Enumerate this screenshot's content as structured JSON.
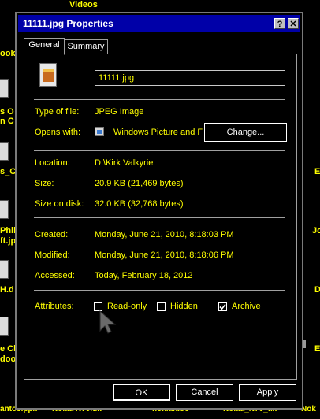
{
  "window": {
    "title": "11111.jpg Properties",
    "help_glyph": "?",
    "close_glyph": "✕"
  },
  "tabs": [
    {
      "label": "General",
      "active": true
    },
    {
      "label": "Summary",
      "active": false
    }
  ],
  "general": {
    "file_name": "11111.jpg",
    "type_label": "Type of file:",
    "type_value": "JPEG Image",
    "opens_label": "Opens with:",
    "opens_value": "Windows Picture and F",
    "change_button": "Change...",
    "location_label": "Location:",
    "location_value": "D:\\Kirk Valkyrie",
    "size_label": "Size:",
    "size_value": "20.9 KB (21,469 bytes)",
    "size_disk_label": "Size on disk:",
    "size_disk_value": "32.0 KB (32,768 bytes)",
    "created_label": "Created:",
    "created_value": "Monday, June 21, 2010, 8:18:03 PM",
    "modified_label": "Modified:",
    "modified_value": "Monday, June 21, 2010, 8:18:06 PM",
    "accessed_label": "Accessed:",
    "accessed_value": "Today, February 18, 2012",
    "attributes_label": "Attributes:",
    "readonly_label": "Read-only",
    "readonly_checked": false,
    "hidden_label": "Hidden",
    "hidden_checked": false,
    "archive_label": "Archive",
    "archive_checked": true
  },
  "footer": {
    "ok": "OK",
    "cancel": "Cancel",
    "apply": "Apply"
  },
  "desktop": {
    "top": "Videos",
    "left": [
      "ook",
      "s O",
      "n C",
      "s_C",
      "Phill",
      "ft.jp",
      "H.d",
      "e Cl",
      "doo",
      "antos.ppx"
    ],
    "bottom": [
      "Nokia N70.tlk",
      "nokia.doc",
      "Nokia_N70_f...",
      "Nok"
    ],
    "right": [
      "E",
      "Jc",
      "D",
      "E"
    ]
  },
  "colors": {
    "text": "#ffff00",
    "title_bar": "#0000a8",
    "background": "#000000",
    "border": "#a0a0a0"
  }
}
